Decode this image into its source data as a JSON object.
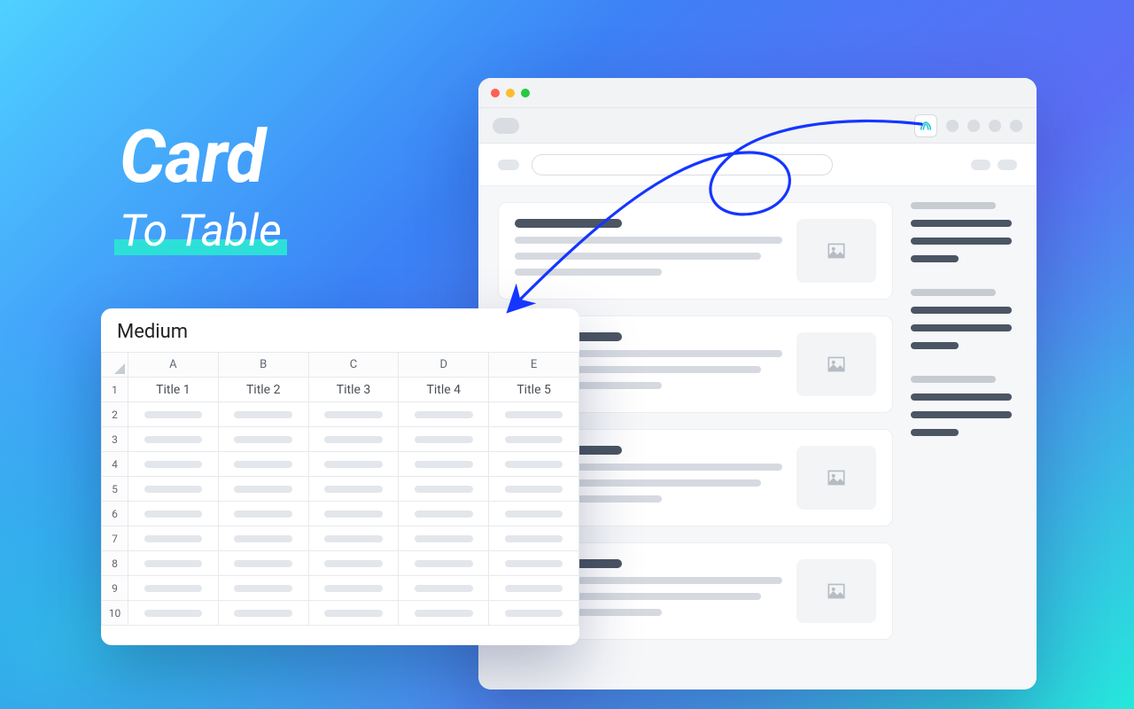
{
  "title": {
    "main": "Card",
    "sub": "To Table"
  },
  "browser": {
    "traffic": [
      "close",
      "minimize",
      "zoom"
    ],
    "extension_icon": "scraper-icon"
  },
  "sheet": {
    "name": "Medium",
    "columns": [
      "A",
      "B",
      "C",
      "D",
      "E"
    ],
    "titles": [
      "Title 1",
      "Title 2",
      "Title 3",
      "Title 4",
      "Title 5"
    ],
    "row_numbers": [
      1,
      2,
      3,
      4,
      5,
      6,
      7,
      8,
      9,
      10
    ]
  }
}
